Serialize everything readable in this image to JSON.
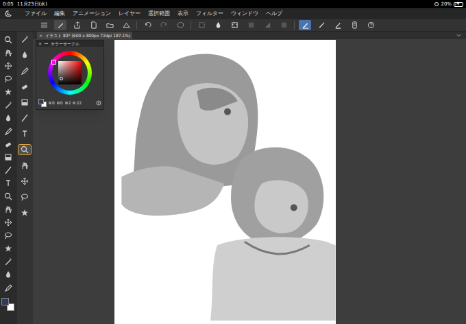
{
  "status_bar": {
    "time": "0:05",
    "date": "11月23日(水)",
    "battery": "20%",
    "battery_level": 0.2,
    "charging": true
  },
  "menu": {
    "items": [
      "ファイル",
      "編集",
      "アニメーション",
      "レイヤー",
      "選択範囲",
      "表示",
      "フィルター",
      "ウィンドウ",
      "ヘルプ"
    ]
  },
  "command_bar": {
    "items": [
      {
        "selected": false
      },
      {
        "selected": true
      },
      {
        "selected": false
      },
      {
        "selected": false
      },
      {
        "selected": false
      },
      {
        "selected": false
      },
      {
        "selected": false
      },
      {
        "selected": false
      },
      {
        "selected": false
      },
      {
        "selected": false
      },
      {
        "selected": false
      },
      {
        "selected": false
      },
      {
        "selected": false
      },
      {
        "selected": false
      },
      {
        "selected": false
      },
      {
        "selected": true
      },
      {
        "selected": false
      },
      {
        "selected": false
      },
      {
        "selected": false
      },
      {
        "selected": false
      }
    ]
  },
  "document_tab": {
    "close": "×",
    "title": "イラスト 83* (600 x 800px 72dpi 187.1%)"
  },
  "color_panel": {
    "title": "カラーサークル",
    "close": "×",
    "values": [
      "0",
      "0",
      "2",
      "22"
    ],
    "swatches": [
      {
        "color": "#2f3b57"
      },
      {
        "color": "#ffffff"
      }
    ]
  },
  "tools": [
    {
      "selected": false
    },
    {
      "selected": false
    },
    {
      "selected": false
    },
    {
      "selected": false
    },
    {
      "selected": false
    },
    {
      "selected": false
    },
    {
      "selected": false
    },
    {
      "selected": false
    },
    {
      "selected": false
    },
    {
      "selected": false
    },
    {
      "selected": false
    },
    {
      "selected": false
    },
    {
      "selected": false
    },
    {
      "selected": false
    },
    {
      "selected": false
    },
    {
      "selected": false
    },
    {
      "selected": false
    },
    {
      "selected": false
    },
    {
      "selected": false
    },
    {
      "selected": false
    }
  ],
  "sub_tools": [
    {
      "selected": false
    },
    {
      "selected": false
    },
    {
      "selected": false
    },
    {
      "selected": false
    },
    {
      "selected": false
    },
    {
      "selected": false
    },
    {
      "selected": false
    },
    {
      "selected": true
    },
    {
      "selected": false
    },
    {
      "selected": false
    },
    {
      "selected": false
    },
    {
      "selected": false
    }
  ]
}
